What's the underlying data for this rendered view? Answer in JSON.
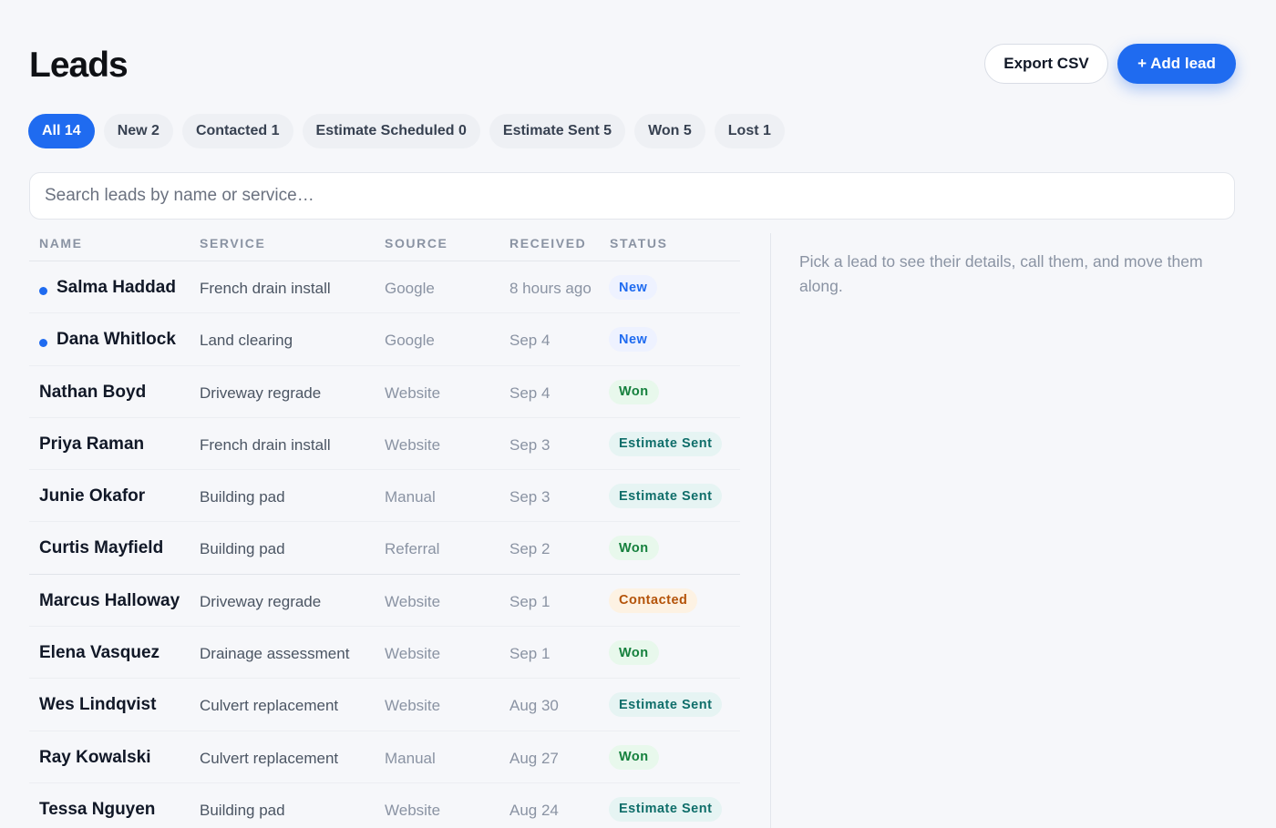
{
  "header": {
    "title": "Leads",
    "export_label": "Export CSV",
    "add_label": "+ Add lead"
  },
  "tabs": [
    {
      "label": "All 14",
      "active": true
    },
    {
      "label": "New 2"
    },
    {
      "label": "Contacted 1"
    },
    {
      "label": "Estimate Scheduled 0"
    },
    {
      "label": "Estimate Sent 5"
    },
    {
      "label": "Won 5"
    },
    {
      "label": "Lost 1"
    }
  ],
  "search": {
    "placeholder": "Search leads by name or service…"
  },
  "table": {
    "columns": [
      "NAME",
      "SERVICE",
      "SOURCE",
      "RECEIVED",
      "STATUS"
    ],
    "rows": [
      {
        "name": "Salma Haddad",
        "service": "French drain install",
        "source": "Google",
        "received": "8 hours ago",
        "status": "New",
        "unread": true
      },
      {
        "name": "Dana Whitlock",
        "service": "Land clearing",
        "source": "Google",
        "received": "Sep 4",
        "status": "New",
        "unread": true
      },
      {
        "name": "Nathan Boyd",
        "service": "Driveway regrade",
        "source": "Website",
        "received": "Sep 4",
        "status": "Won"
      },
      {
        "name": "Priya Raman",
        "service": "French drain install",
        "source": "Website",
        "received": "Sep 3",
        "status": "Estimate Sent"
      },
      {
        "name": "Junie Okafor",
        "service": "Building pad",
        "source": "Manual",
        "received": "Sep 3",
        "status": "Estimate Sent"
      },
      {
        "name": "Curtis Mayfield",
        "service": "Building pad",
        "source": "Referral",
        "received": "Sep 2",
        "status": "Won"
      },
      {
        "name": "Marcus Halloway",
        "service": "Driveway regrade",
        "source": "Website",
        "received": "Sep 1",
        "status": "Contacted"
      },
      {
        "name": "Elena Vasquez",
        "service": "Drainage assessment",
        "source": "Website",
        "received": "Sep 1",
        "status": "Won"
      },
      {
        "name": "Wes Lindqvist",
        "service": "Culvert replacement",
        "source": "Website",
        "received": "Aug 30",
        "status": "Estimate Sent"
      },
      {
        "name": "Ray Kowalski",
        "service": "Culvert replacement",
        "source": "Manual",
        "received": "Aug 27",
        "status": "Won"
      },
      {
        "name": "Tessa Nguyen",
        "service": "Building pad",
        "source": "Website",
        "received": "Aug 24",
        "status": "Estimate Sent"
      }
    ]
  },
  "detail": {
    "hint": "Pick a lead to see their details, call them, and move them along."
  },
  "colors": {
    "accent": "#1f6bf0",
    "new": "#1f6bf0",
    "won": "#15803d",
    "estimate_sent": "#0f6e6a",
    "contacted": "#b45309"
  }
}
